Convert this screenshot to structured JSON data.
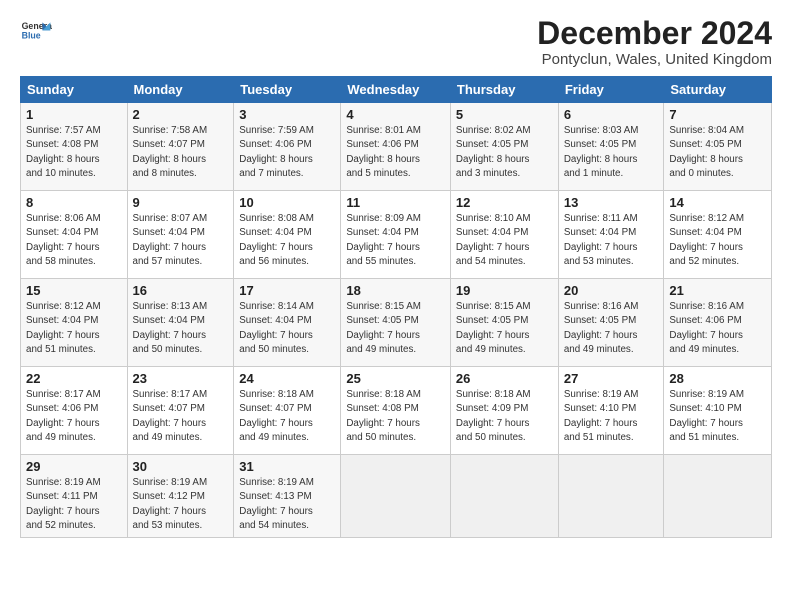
{
  "logo": {
    "line1": "General",
    "line2": "Blue"
  },
  "title": "December 2024",
  "subtitle": "Pontyclun, Wales, United Kingdom",
  "headers": [
    "Sunday",
    "Monday",
    "Tuesday",
    "Wednesday",
    "Thursday",
    "Friday",
    "Saturday"
  ],
  "weeks": [
    [
      {
        "day": "1",
        "info": "Sunrise: 7:57 AM\nSunset: 4:08 PM\nDaylight: 8 hours\nand 10 minutes."
      },
      {
        "day": "2",
        "info": "Sunrise: 7:58 AM\nSunset: 4:07 PM\nDaylight: 8 hours\nand 8 minutes."
      },
      {
        "day": "3",
        "info": "Sunrise: 7:59 AM\nSunset: 4:06 PM\nDaylight: 8 hours\nand 7 minutes."
      },
      {
        "day": "4",
        "info": "Sunrise: 8:01 AM\nSunset: 4:06 PM\nDaylight: 8 hours\nand 5 minutes."
      },
      {
        "day": "5",
        "info": "Sunrise: 8:02 AM\nSunset: 4:05 PM\nDaylight: 8 hours\nand 3 minutes."
      },
      {
        "day": "6",
        "info": "Sunrise: 8:03 AM\nSunset: 4:05 PM\nDaylight: 8 hours\nand 1 minute."
      },
      {
        "day": "7",
        "info": "Sunrise: 8:04 AM\nSunset: 4:05 PM\nDaylight: 8 hours\nand 0 minutes."
      }
    ],
    [
      {
        "day": "8",
        "info": "Sunrise: 8:06 AM\nSunset: 4:04 PM\nDaylight: 7 hours\nand 58 minutes."
      },
      {
        "day": "9",
        "info": "Sunrise: 8:07 AM\nSunset: 4:04 PM\nDaylight: 7 hours\nand 57 minutes."
      },
      {
        "day": "10",
        "info": "Sunrise: 8:08 AM\nSunset: 4:04 PM\nDaylight: 7 hours\nand 56 minutes."
      },
      {
        "day": "11",
        "info": "Sunrise: 8:09 AM\nSunset: 4:04 PM\nDaylight: 7 hours\nand 55 minutes."
      },
      {
        "day": "12",
        "info": "Sunrise: 8:10 AM\nSunset: 4:04 PM\nDaylight: 7 hours\nand 54 minutes."
      },
      {
        "day": "13",
        "info": "Sunrise: 8:11 AM\nSunset: 4:04 PM\nDaylight: 7 hours\nand 53 minutes."
      },
      {
        "day": "14",
        "info": "Sunrise: 8:12 AM\nSunset: 4:04 PM\nDaylight: 7 hours\nand 52 minutes."
      }
    ],
    [
      {
        "day": "15",
        "info": "Sunrise: 8:12 AM\nSunset: 4:04 PM\nDaylight: 7 hours\nand 51 minutes."
      },
      {
        "day": "16",
        "info": "Sunrise: 8:13 AM\nSunset: 4:04 PM\nDaylight: 7 hours\nand 50 minutes."
      },
      {
        "day": "17",
        "info": "Sunrise: 8:14 AM\nSunset: 4:04 PM\nDaylight: 7 hours\nand 50 minutes."
      },
      {
        "day": "18",
        "info": "Sunrise: 8:15 AM\nSunset: 4:05 PM\nDaylight: 7 hours\nand 49 minutes."
      },
      {
        "day": "19",
        "info": "Sunrise: 8:15 AM\nSunset: 4:05 PM\nDaylight: 7 hours\nand 49 minutes."
      },
      {
        "day": "20",
        "info": "Sunrise: 8:16 AM\nSunset: 4:05 PM\nDaylight: 7 hours\nand 49 minutes."
      },
      {
        "day": "21",
        "info": "Sunrise: 8:16 AM\nSunset: 4:06 PM\nDaylight: 7 hours\nand 49 minutes."
      }
    ],
    [
      {
        "day": "22",
        "info": "Sunrise: 8:17 AM\nSunset: 4:06 PM\nDaylight: 7 hours\nand 49 minutes."
      },
      {
        "day": "23",
        "info": "Sunrise: 8:17 AM\nSunset: 4:07 PM\nDaylight: 7 hours\nand 49 minutes."
      },
      {
        "day": "24",
        "info": "Sunrise: 8:18 AM\nSunset: 4:07 PM\nDaylight: 7 hours\nand 49 minutes."
      },
      {
        "day": "25",
        "info": "Sunrise: 8:18 AM\nSunset: 4:08 PM\nDaylight: 7 hours\nand 50 minutes."
      },
      {
        "day": "26",
        "info": "Sunrise: 8:18 AM\nSunset: 4:09 PM\nDaylight: 7 hours\nand 50 minutes."
      },
      {
        "day": "27",
        "info": "Sunrise: 8:19 AM\nSunset: 4:10 PM\nDaylight: 7 hours\nand 51 minutes."
      },
      {
        "day": "28",
        "info": "Sunrise: 8:19 AM\nSunset: 4:10 PM\nDaylight: 7 hours\nand 51 minutes."
      }
    ],
    [
      {
        "day": "29",
        "info": "Sunrise: 8:19 AM\nSunset: 4:11 PM\nDaylight: 7 hours\nand 52 minutes."
      },
      {
        "day": "30",
        "info": "Sunrise: 8:19 AM\nSunset: 4:12 PM\nDaylight: 7 hours\nand 53 minutes."
      },
      {
        "day": "31",
        "info": "Sunrise: 8:19 AM\nSunset: 4:13 PM\nDaylight: 7 hours\nand 54 minutes."
      },
      {
        "day": "",
        "info": ""
      },
      {
        "day": "",
        "info": ""
      },
      {
        "day": "",
        "info": ""
      },
      {
        "day": "",
        "info": ""
      }
    ]
  ]
}
